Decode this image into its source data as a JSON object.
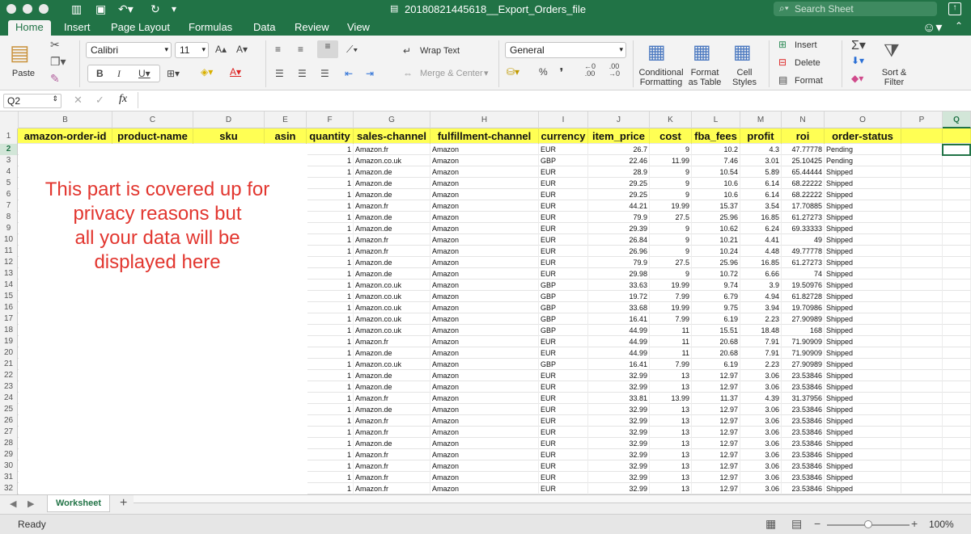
{
  "window": {
    "title": "20180821445618__Export_Orders_file",
    "search_placeholder": "Search Sheet"
  },
  "tabs": [
    "Home",
    "Insert",
    "Page Layout",
    "Formulas",
    "Data",
    "Review",
    "View"
  ],
  "ribbon": {
    "paste": "Paste",
    "font_name": "Calibri",
    "font_size": "11",
    "wrap_text": "Wrap Text",
    "merge_center": "Merge & Center",
    "number_format": "General",
    "conditional_formatting": "Conditional Formatting",
    "format_as_table": "Format as Table",
    "cell_styles": "Cell Styles",
    "insert": "Insert",
    "delete": "Delete",
    "format": "Format",
    "sort_filter": "Sort & Filter"
  },
  "formula_bar": {
    "name_box": "Q2",
    "fx": "fx",
    "value": ""
  },
  "columns": [
    "B",
    "C",
    "D",
    "E",
    "F",
    "G",
    "H",
    "I",
    "J",
    "K",
    "L",
    "M",
    "N",
    "O",
    "P",
    "Q"
  ],
  "header_row": [
    "amazon-order-id",
    "product-name",
    "sku",
    "asin",
    "quantity",
    "sales-channel",
    "fulfillment-channel",
    "currency",
    "item_price",
    "cost",
    "fba_fees",
    "profit",
    "roi",
    "order-status"
  ],
  "privacy_note": "This part is covered up for\nprivacy reasons but\nall your data will be\ndisplayed here",
  "rows": [
    {
      "n": "2",
      "q": "1",
      "ch": "Amazon.fr",
      "f": "Amazon",
      "cur": "EUR",
      "p": "26.7",
      "c": "9",
      "fba": "10.2",
      "pr": "4.3",
      "roi": "47.77778",
      "s": "Pending"
    },
    {
      "n": "3",
      "q": "1",
      "ch": "Amazon.co.uk",
      "f": "Amazon",
      "cur": "GBP",
      "p": "22.46",
      "c": "11.99",
      "fba": "7.46",
      "pr": "3.01",
      "roi": "25.10425",
      "s": "Pending"
    },
    {
      "n": "4",
      "q": "1",
      "ch": "Amazon.de",
      "f": "Amazon",
      "cur": "EUR",
      "p": "28.9",
      "c": "9",
      "fba": "10.54",
      "pr": "5.89",
      "roi": "65.44444",
      "s": "Shipped"
    },
    {
      "n": "5",
      "q": "1",
      "ch": "Amazon.de",
      "f": "Amazon",
      "cur": "EUR",
      "p": "29.25",
      "c": "9",
      "fba": "10.6",
      "pr": "6.14",
      "roi": "68.22222",
      "s": "Shipped"
    },
    {
      "n": "6",
      "q": "1",
      "ch": "Amazon.de",
      "f": "Amazon",
      "cur": "EUR",
      "p": "29.25",
      "c": "9",
      "fba": "10.6",
      "pr": "6.14",
      "roi": "68.22222",
      "s": "Shipped"
    },
    {
      "n": "7",
      "q": "1",
      "ch": "Amazon.fr",
      "f": "Amazon",
      "cur": "EUR",
      "p": "44.21",
      "c": "19.99",
      "fba": "15.37",
      "pr": "3.54",
      "roi": "17.70885",
      "s": "Shipped"
    },
    {
      "n": "8",
      "q": "1",
      "ch": "Amazon.de",
      "f": "Amazon",
      "cur": "EUR",
      "p": "79.9",
      "c": "27.5",
      "fba": "25.96",
      "pr": "16.85",
      "roi": "61.27273",
      "s": "Shipped"
    },
    {
      "n": "9",
      "q": "1",
      "ch": "Amazon.de",
      "f": "Amazon",
      "cur": "EUR",
      "p": "29.39",
      "c": "9",
      "fba": "10.62",
      "pr": "6.24",
      "roi": "69.33333",
      "s": "Shipped"
    },
    {
      "n": "10",
      "q": "1",
      "ch": "Amazon.fr",
      "f": "Amazon",
      "cur": "EUR",
      "p": "26.84",
      "c": "9",
      "fba": "10.21",
      "pr": "4.41",
      "roi": "49",
      "s": "Shipped"
    },
    {
      "n": "11",
      "q": "1",
      "ch": "Amazon.fr",
      "f": "Amazon",
      "cur": "EUR",
      "p": "26.96",
      "c": "9",
      "fba": "10.24",
      "pr": "4.48",
      "roi": "49.77778",
      "s": "Shipped"
    },
    {
      "n": "12",
      "q": "1",
      "ch": "Amazon.de",
      "f": "Amazon",
      "cur": "EUR",
      "p": "79.9",
      "c": "27.5",
      "fba": "25.96",
      "pr": "16.85",
      "roi": "61.27273",
      "s": "Shipped"
    },
    {
      "n": "13",
      "q": "1",
      "ch": "Amazon.de",
      "f": "Amazon",
      "cur": "EUR",
      "p": "29.98",
      "c": "9",
      "fba": "10.72",
      "pr": "6.66",
      "roi": "74",
      "s": "Shipped"
    },
    {
      "n": "14",
      "q": "1",
      "ch": "Amazon.co.uk",
      "f": "Amazon",
      "cur": "GBP",
      "p": "33.63",
      "c": "19.99",
      "fba": "9.74",
      "pr": "3.9",
      "roi": "19.50976",
      "s": "Shipped"
    },
    {
      "n": "15",
      "q": "1",
      "ch": "Amazon.co.uk",
      "f": "Amazon",
      "cur": "GBP",
      "p": "19.72",
      "c": "7.99",
      "fba": "6.79",
      "pr": "4.94",
      "roi": "61.82728",
      "s": "Shipped"
    },
    {
      "n": "16",
      "q": "1",
      "ch": "Amazon.co.uk",
      "f": "Amazon",
      "cur": "GBP",
      "p": "33.68",
      "c": "19.99",
      "fba": "9.75",
      "pr": "3.94",
      "roi": "19.70986",
      "s": "Shipped"
    },
    {
      "n": "17",
      "q": "1",
      "ch": "Amazon.co.uk",
      "f": "Amazon",
      "cur": "GBP",
      "p": "16.41",
      "c": "7.99",
      "fba": "6.19",
      "pr": "2.23",
      "roi": "27.90989",
      "s": "Shipped"
    },
    {
      "n": "18",
      "q": "1",
      "ch": "Amazon.co.uk",
      "f": "Amazon",
      "cur": "GBP",
      "p": "44.99",
      "c": "11",
      "fba": "15.51",
      "pr": "18.48",
      "roi": "168",
      "s": "Shipped"
    },
    {
      "n": "19",
      "q": "1",
      "ch": "Amazon.fr",
      "f": "Amazon",
      "cur": "EUR",
      "p": "44.99",
      "c": "11",
      "fba": "20.68",
      "pr": "7.91",
      "roi": "71.90909",
      "s": "Shipped"
    },
    {
      "n": "20",
      "q": "1",
      "ch": "Amazon.de",
      "f": "Amazon",
      "cur": "EUR",
      "p": "44.99",
      "c": "11",
      "fba": "20.68",
      "pr": "7.91",
      "roi": "71.90909",
      "s": "Shipped"
    },
    {
      "n": "21",
      "q": "1",
      "ch": "Amazon.co.uk",
      "f": "Amazon",
      "cur": "GBP",
      "p": "16.41",
      "c": "7.99",
      "fba": "6.19",
      "pr": "2.23",
      "roi": "27.90989",
      "s": "Shipped"
    },
    {
      "n": "22",
      "q": "1",
      "ch": "Amazon.de",
      "f": "Amazon",
      "cur": "EUR",
      "p": "32.99",
      "c": "13",
      "fba": "12.97",
      "pr": "3.06",
      "roi": "23.53846",
      "s": "Shipped"
    },
    {
      "n": "23",
      "q": "1",
      "ch": "Amazon.de",
      "f": "Amazon",
      "cur": "EUR",
      "p": "32.99",
      "c": "13",
      "fba": "12.97",
      "pr": "3.06",
      "roi": "23.53846",
      "s": "Shipped"
    },
    {
      "n": "24",
      "q": "1",
      "ch": "Amazon.fr",
      "f": "Amazon",
      "cur": "EUR",
      "p": "33.81",
      "c": "13.99",
      "fba": "11.37",
      "pr": "4.39",
      "roi": "31.37956",
      "s": "Shipped"
    },
    {
      "n": "25",
      "q": "1",
      "ch": "Amazon.de",
      "f": "Amazon",
      "cur": "EUR",
      "p": "32.99",
      "c": "13",
      "fba": "12.97",
      "pr": "3.06",
      "roi": "23.53846",
      "s": "Shipped"
    },
    {
      "n": "26",
      "q": "1",
      "ch": "Amazon.fr",
      "f": "Amazon",
      "cur": "EUR",
      "p": "32.99",
      "c": "13",
      "fba": "12.97",
      "pr": "3.06",
      "roi": "23.53846",
      "s": "Shipped"
    },
    {
      "n": "27",
      "q": "1",
      "ch": "Amazon.fr",
      "f": "Amazon",
      "cur": "EUR",
      "p": "32.99",
      "c": "13",
      "fba": "12.97",
      "pr": "3.06",
      "roi": "23.53846",
      "s": "Shipped"
    },
    {
      "n": "28",
      "q": "1",
      "ch": "Amazon.de",
      "f": "Amazon",
      "cur": "EUR",
      "p": "32.99",
      "c": "13",
      "fba": "12.97",
      "pr": "3.06",
      "roi": "23.53846",
      "s": "Shipped"
    },
    {
      "n": "29",
      "q": "1",
      "ch": "Amazon.fr",
      "f": "Amazon",
      "cur": "EUR",
      "p": "32.99",
      "c": "13",
      "fba": "12.97",
      "pr": "3.06",
      "roi": "23.53846",
      "s": "Shipped"
    },
    {
      "n": "30",
      "q": "1",
      "ch": "Amazon.fr",
      "f": "Amazon",
      "cur": "EUR",
      "p": "32.99",
      "c": "13",
      "fba": "12.97",
      "pr": "3.06",
      "roi": "23.53846",
      "s": "Shipped"
    },
    {
      "n": "31",
      "q": "1",
      "ch": "Amazon.fr",
      "f": "Amazon",
      "cur": "EUR",
      "p": "32.99",
      "c": "13",
      "fba": "12.97",
      "pr": "3.06",
      "roi": "23.53846",
      "s": "Shipped"
    },
    {
      "n": "32",
      "q": "1",
      "ch": "Amazon.fr",
      "f": "Amazon",
      "cur": "EUR",
      "p": "32.99",
      "c": "13",
      "fba": "12.97",
      "pr": "3.06",
      "roi": "23.53846",
      "s": "Shipped"
    }
  ],
  "sheet_tab": "Worksheet",
  "add_sheet": "+",
  "status": {
    "ready": "Ready",
    "zoom": "100%"
  },
  "colors": {
    "excel_green": "#217346",
    "header_fill": "#ffff54",
    "privacy_text": "#e2362f"
  }
}
